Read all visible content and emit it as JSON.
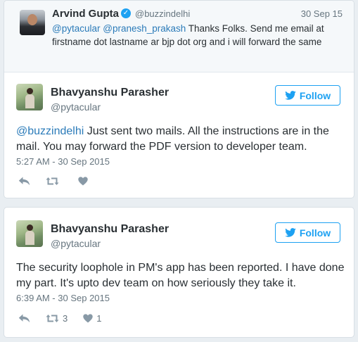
{
  "reply": {
    "name": "Arvind Gupta",
    "handle": "@buzzindelhi",
    "date": "30 Sep 15",
    "mentions": [
      "@pytacular",
      "@pranesh_prakash"
    ],
    "text": " Thanks Folks. Send me email at firstname dot lastname ar bjp dot org and i will forward the same"
  },
  "tweets": [
    {
      "name": "Bhavyanshu Parasher",
      "handle": "@pytacular",
      "follow_label": "Follow",
      "mention": "@buzzindelhi",
      "text": " Just sent two mails. All the instructions are in the mail. You may forward the PDF version to developer team.",
      "timestamp": "5:27 AM - 30 Sep 2015",
      "retweets": "",
      "likes": ""
    },
    {
      "name": "Bhavyanshu Parasher",
      "handle": "@pytacular",
      "follow_label": "Follow",
      "text": "The security loophole in PM's app has been reported. I have done my part. It's upto dev team on how seriously they take it.",
      "timestamp": "6:39 AM - 30 Sep 2015",
      "retweets": "3",
      "likes": "1"
    }
  ],
  "icons": {
    "reply": "reply-icon",
    "retweet": "retweet-icon",
    "like": "heart-icon",
    "bird": "twitter-bird-icon",
    "verified": "verified-badge-icon"
  },
  "colors": {
    "accent": "#1da1f2",
    "link": "#2b7bb9",
    "muted": "#66757f",
    "icon": "#8899a6"
  }
}
